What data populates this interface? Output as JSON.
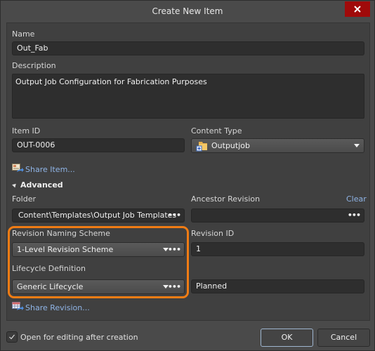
{
  "window": {
    "title": "Create New Item",
    "close_icon": "close-x-icon"
  },
  "name": {
    "label": "Name",
    "value": "Out_Fab"
  },
  "description": {
    "label": "Description",
    "value": "Output Job Configuration for Fabrication Purposes"
  },
  "item_id": {
    "label": "Item ID",
    "value": "OUT-0006"
  },
  "content_type": {
    "label": "Content Type",
    "value": "Outputjob",
    "icon": "outputjob-folder-icon"
  },
  "share_item": {
    "label": "Share Item...",
    "icon": "share-item-icon"
  },
  "advanced": {
    "label": "Advanced",
    "expanded": true
  },
  "folder": {
    "label": "Folder",
    "value": "Content\\Templates\\Output Job Templates",
    "browse": "•••"
  },
  "ancestor_revision": {
    "label": "Ancestor Revision",
    "clear_label": "Clear",
    "value": "",
    "browse": "•••"
  },
  "revision_naming_scheme": {
    "label": "Revision Naming Scheme",
    "value": "1-Level Revision Scheme",
    "browse": "•••"
  },
  "revision_id": {
    "label": "Revision ID",
    "value": "1"
  },
  "lifecycle_definition": {
    "label": "Lifecycle Definition",
    "value": "Generic Lifecycle",
    "browse": "•••"
  },
  "lifecycle_state": {
    "value": "Planned"
  },
  "share_revision": {
    "label": "Share Revision...",
    "icon": "share-revision-icon"
  },
  "open_for_editing": {
    "label": "Open for editing after creation",
    "checked": true
  },
  "buttons": {
    "ok": "OK",
    "cancel": "Cancel"
  },
  "colors": {
    "highlight": "#f07c14",
    "close_button": "#a00a0a",
    "link": "#8fb4e6"
  }
}
